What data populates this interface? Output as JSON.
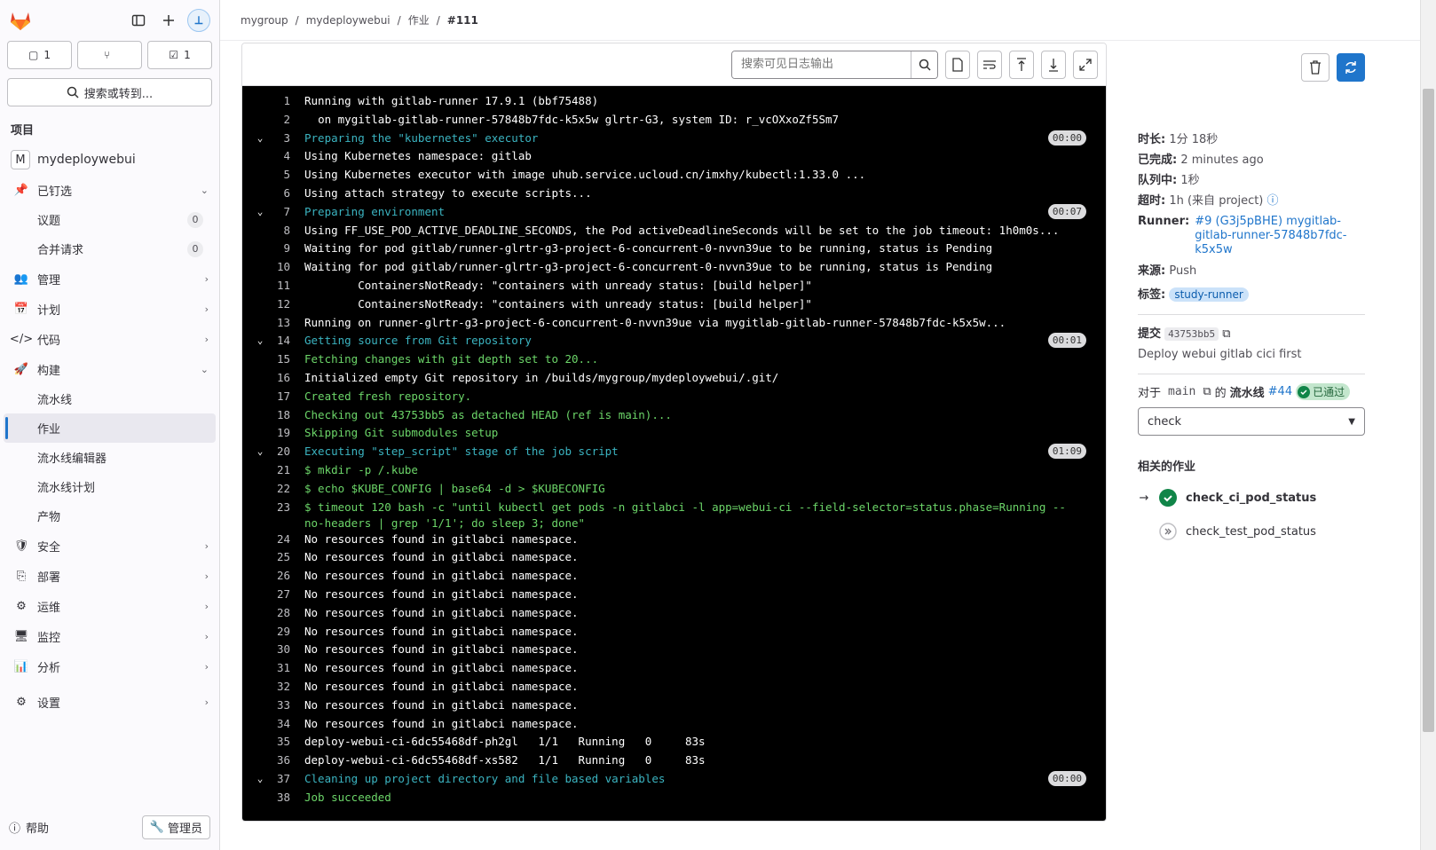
{
  "sidebar": {
    "counts": {
      "issues": "1",
      "merge_requests": "",
      "todos": "1"
    },
    "search_label": "搜索或转到...",
    "section_title": "项目",
    "project": {
      "initial": "M",
      "name": "mydeploywebui"
    },
    "pinned": {
      "label": "已钉选",
      "items": [
        {
          "label": "议题",
          "count": "0"
        },
        {
          "label": "合并请求",
          "count": "0"
        }
      ]
    },
    "nav": {
      "manage": "管理",
      "plan": "计划",
      "code": "代码",
      "build": "构建",
      "build_items": [
        "流水线",
        "作业",
        "流水线编辑器",
        "流水线计划",
        "产物"
      ],
      "secure": "安全",
      "deploy": "部署",
      "operate": "运维",
      "monitor": "监控",
      "analyze": "分析",
      "settings": "设置"
    },
    "help": "帮助",
    "admin": "管理员"
  },
  "breadcrumb": [
    "mygroup",
    "mydeploywebui",
    "作业",
    "#111"
  ],
  "log": {
    "search_placeholder": "搜索可见日志输出",
    "lines": [
      {
        "n": "1",
        "t": "Running with gitlab-runner 17.9.1 (bbf75488)",
        "c": ""
      },
      {
        "n": "2",
        "t": "  on mygitlab-gitlab-runner-57848b7fdc-k5x5w glrtr-G3, system ID: r_vcOXxoZf5Sm7",
        "c": ""
      },
      {
        "n": "3",
        "t": "Preparing the \"kubernetes\" executor",
        "c": "cyan",
        "sec": true,
        "d": "00:00"
      },
      {
        "n": "4",
        "t": "Using Kubernetes namespace: gitlab",
        "c": ""
      },
      {
        "n": "5",
        "t": "Using Kubernetes executor with image uhub.service.ucloud.cn/imxhy/kubectl:1.33.0 ...",
        "c": ""
      },
      {
        "n": "6",
        "t": "Using attach strategy to execute scripts...",
        "c": ""
      },
      {
        "n": "7",
        "t": "Preparing environment",
        "c": "cyan",
        "sec": true,
        "d": "00:07"
      },
      {
        "n": "8",
        "t": "Using FF_USE_POD_ACTIVE_DEADLINE_SECONDS, the Pod activeDeadlineSeconds will be set to the job timeout: 1h0m0s...",
        "c": ""
      },
      {
        "n": "9",
        "t": "Waiting for pod gitlab/runner-glrtr-g3-project-6-concurrent-0-nvvn39ue to be running, status is Pending",
        "c": ""
      },
      {
        "n": "10",
        "t": "Waiting for pod gitlab/runner-glrtr-g3-project-6-concurrent-0-nvvn39ue to be running, status is Pending",
        "c": ""
      },
      {
        "n": "11",
        "t": "        ContainersNotReady: \"containers with unready status: [build helper]\"",
        "c": ""
      },
      {
        "n": "12",
        "t": "        ContainersNotReady: \"containers with unready status: [build helper]\"",
        "c": ""
      },
      {
        "n": "13",
        "t": "Running on runner-glrtr-g3-project-6-concurrent-0-nvvn39ue via mygitlab-gitlab-runner-57848b7fdc-k5x5w...",
        "c": ""
      },
      {
        "n": "14",
        "t": "Getting source from Git repository",
        "c": "cyan",
        "sec": true,
        "d": "00:01"
      },
      {
        "n": "15",
        "t": "Fetching changes with git depth set to 20...",
        "c": "green"
      },
      {
        "n": "16",
        "t": "Initialized empty Git repository in /builds/mygroup/mydeploywebui/.git/",
        "c": ""
      },
      {
        "n": "17",
        "t": "Created fresh repository.",
        "c": "green"
      },
      {
        "n": "18",
        "t": "Checking out 43753bb5 as detached HEAD (ref is main)...",
        "c": "green"
      },
      {
        "n": "19",
        "t": "Skipping Git submodules setup",
        "c": "green"
      },
      {
        "n": "20",
        "t": "Executing \"step_script\" stage of the job script",
        "c": "cyan",
        "sec": true,
        "d": "01:09"
      },
      {
        "n": "21",
        "t": "$ mkdir -p /.kube",
        "c": "green"
      },
      {
        "n": "22",
        "t": "$ echo $KUBE_CONFIG | base64 -d > $KUBECONFIG",
        "c": "green"
      },
      {
        "n": "23",
        "t": "$ timeout 120 bash -c \"until kubectl get pods -n gitlabci -l app=webui-ci --field-selector=status.phase=Running --no-headers | grep '1/1'; do sleep 3; done\"",
        "c": "green"
      },
      {
        "n": "24",
        "t": "No resources found in gitlabci namespace.",
        "c": ""
      },
      {
        "n": "25",
        "t": "No resources found in gitlabci namespace.",
        "c": ""
      },
      {
        "n": "26",
        "t": "No resources found in gitlabci namespace.",
        "c": ""
      },
      {
        "n": "27",
        "t": "No resources found in gitlabci namespace.",
        "c": ""
      },
      {
        "n": "28",
        "t": "No resources found in gitlabci namespace.",
        "c": ""
      },
      {
        "n": "29",
        "t": "No resources found in gitlabci namespace.",
        "c": ""
      },
      {
        "n": "30",
        "t": "No resources found in gitlabci namespace.",
        "c": ""
      },
      {
        "n": "31",
        "t": "No resources found in gitlabci namespace.",
        "c": ""
      },
      {
        "n": "32",
        "t": "No resources found in gitlabci namespace.",
        "c": ""
      },
      {
        "n": "33",
        "t": "No resources found in gitlabci namespace.",
        "c": ""
      },
      {
        "n": "34",
        "t": "No resources found in gitlabci namespace.",
        "c": ""
      },
      {
        "n": "35",
        "t": "deploy-webui-ci-6dc55468df-ph2gl   1/1   Running   0     83s",
        "c": ""
      },
      {
        "n": "36",
        "t": "deploy-webui-ci-6dc55468df-xs582   1/1   Running   0     83s",
        "c": ""
      },
      {
        "n": "37",
        "t": "Cleaning up project directory and file based variables",
        "c": "cyan",
        "sec": true,
        "d": "00:00"
      },
      {
        "n": "38",
        "t": "Job succeeded",
        "c": "green"
      }
    ]
  },
  "job": {
    "duration_label": "时长:",
    "duration": "1分 18秒",
    "finished_label": "已完成:",
    "finished": "2 minutes ago",
    "queued_label": "队列中:",
    "queued": "1秒",
    "timeout_label": "超时:",
    "timeout": "1h (来自 project)",
    "runner_label": "Runner:",
    "runner": "#9 (G3j5pBHE) mygitlab-gitlab-runner-57848b7fdc-k5x5w",
    "source_label": "来源:",
    "source": "Push",
    "tags_label": "标签:",
    "tag": "study-runner",
    "commit_label": "提交",
    "commit_sha": "43753bb5",
    "commit_msg": "Deploy webui gitlab cici first",
    "pipeline_prefix": "对于",
    "branch": "main",
    "pipeline_of": "的",
    "pipeline_label": "流水线",
    "pipeline_id": "#44",
    "pipeline_status": "已通过",
    "stage": "check",
    "related_title": "相关的作业",
    "related": [
      {
        "name": "check_ci_pod_status"
      },
      {
        "name": "check_test_pod_status"
      }
    ]
  },
  "colors": {
    "accent": "#1f75cb",
    "log_bg": "#000000",
    "log_cyan": "#3bb4c1",
    "log_green": "#6cd669",
    "success": "#108548"
  }
}
